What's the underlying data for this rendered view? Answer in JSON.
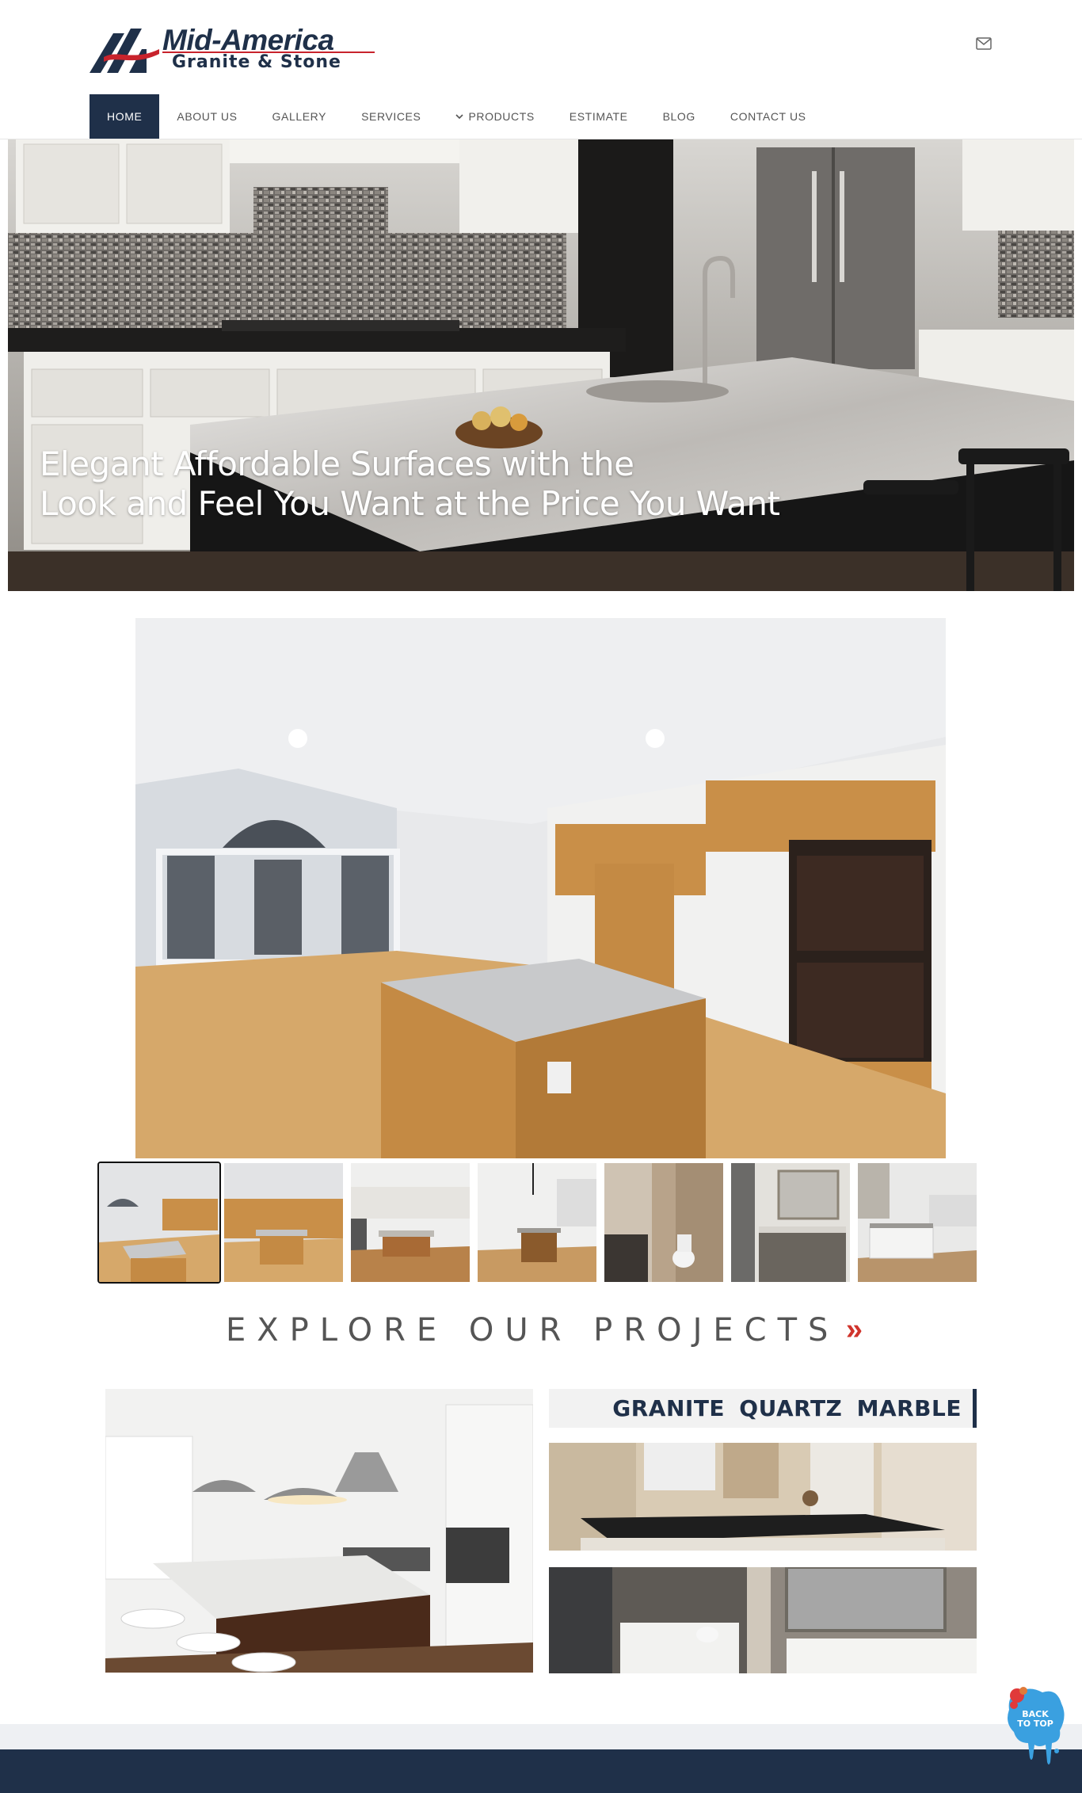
{
  "brand": {
    "name_line1": "Mid-America",
    "name_line2": "Granite & Stone",
    "colors": {
      "navy": "#1f3049",
      "red": "#c8232c"
    }
  },
  "header": {
    "contact_icon": "envelope-icon"
  },
  "nav": {
    "items": [
      {
        "label": "HOME",
        "active": true
      },
      {
        "label": "ABOUT US"
      },
      {
        "label": "GALLERY"
      },
      {
        "label": "SERVICES"
      },
      {
        "label": "PRODUCTS",
        "icon": "chevron-down-icon"
      },
      {
        "label": "ESTIMATE"
      },
      {
        "label": "BLOG"
      },
      {
        "label": "CONTACT US"
      }
    ]
  },
  "hero": {
    "headline_line1": "Elegant Affordable Surfaces with the",
    "headline_line2": "Look and Feel You Want at the Price You Want"
  },
  "gallery": {
    "thumbnail_count": 7,
    "selected_index": 0
  },
  "explore": {
    "label": "EXPLORE OUR PROJECTS",
    "arrow": "»"
  },
  "projects": {
    "materials_label": "GRANITE  QUARTZ  MARBLE"
  },
  "back_to_top": {
    "line1": "BACK",
    "line2": "TO TOP"
  }
}
